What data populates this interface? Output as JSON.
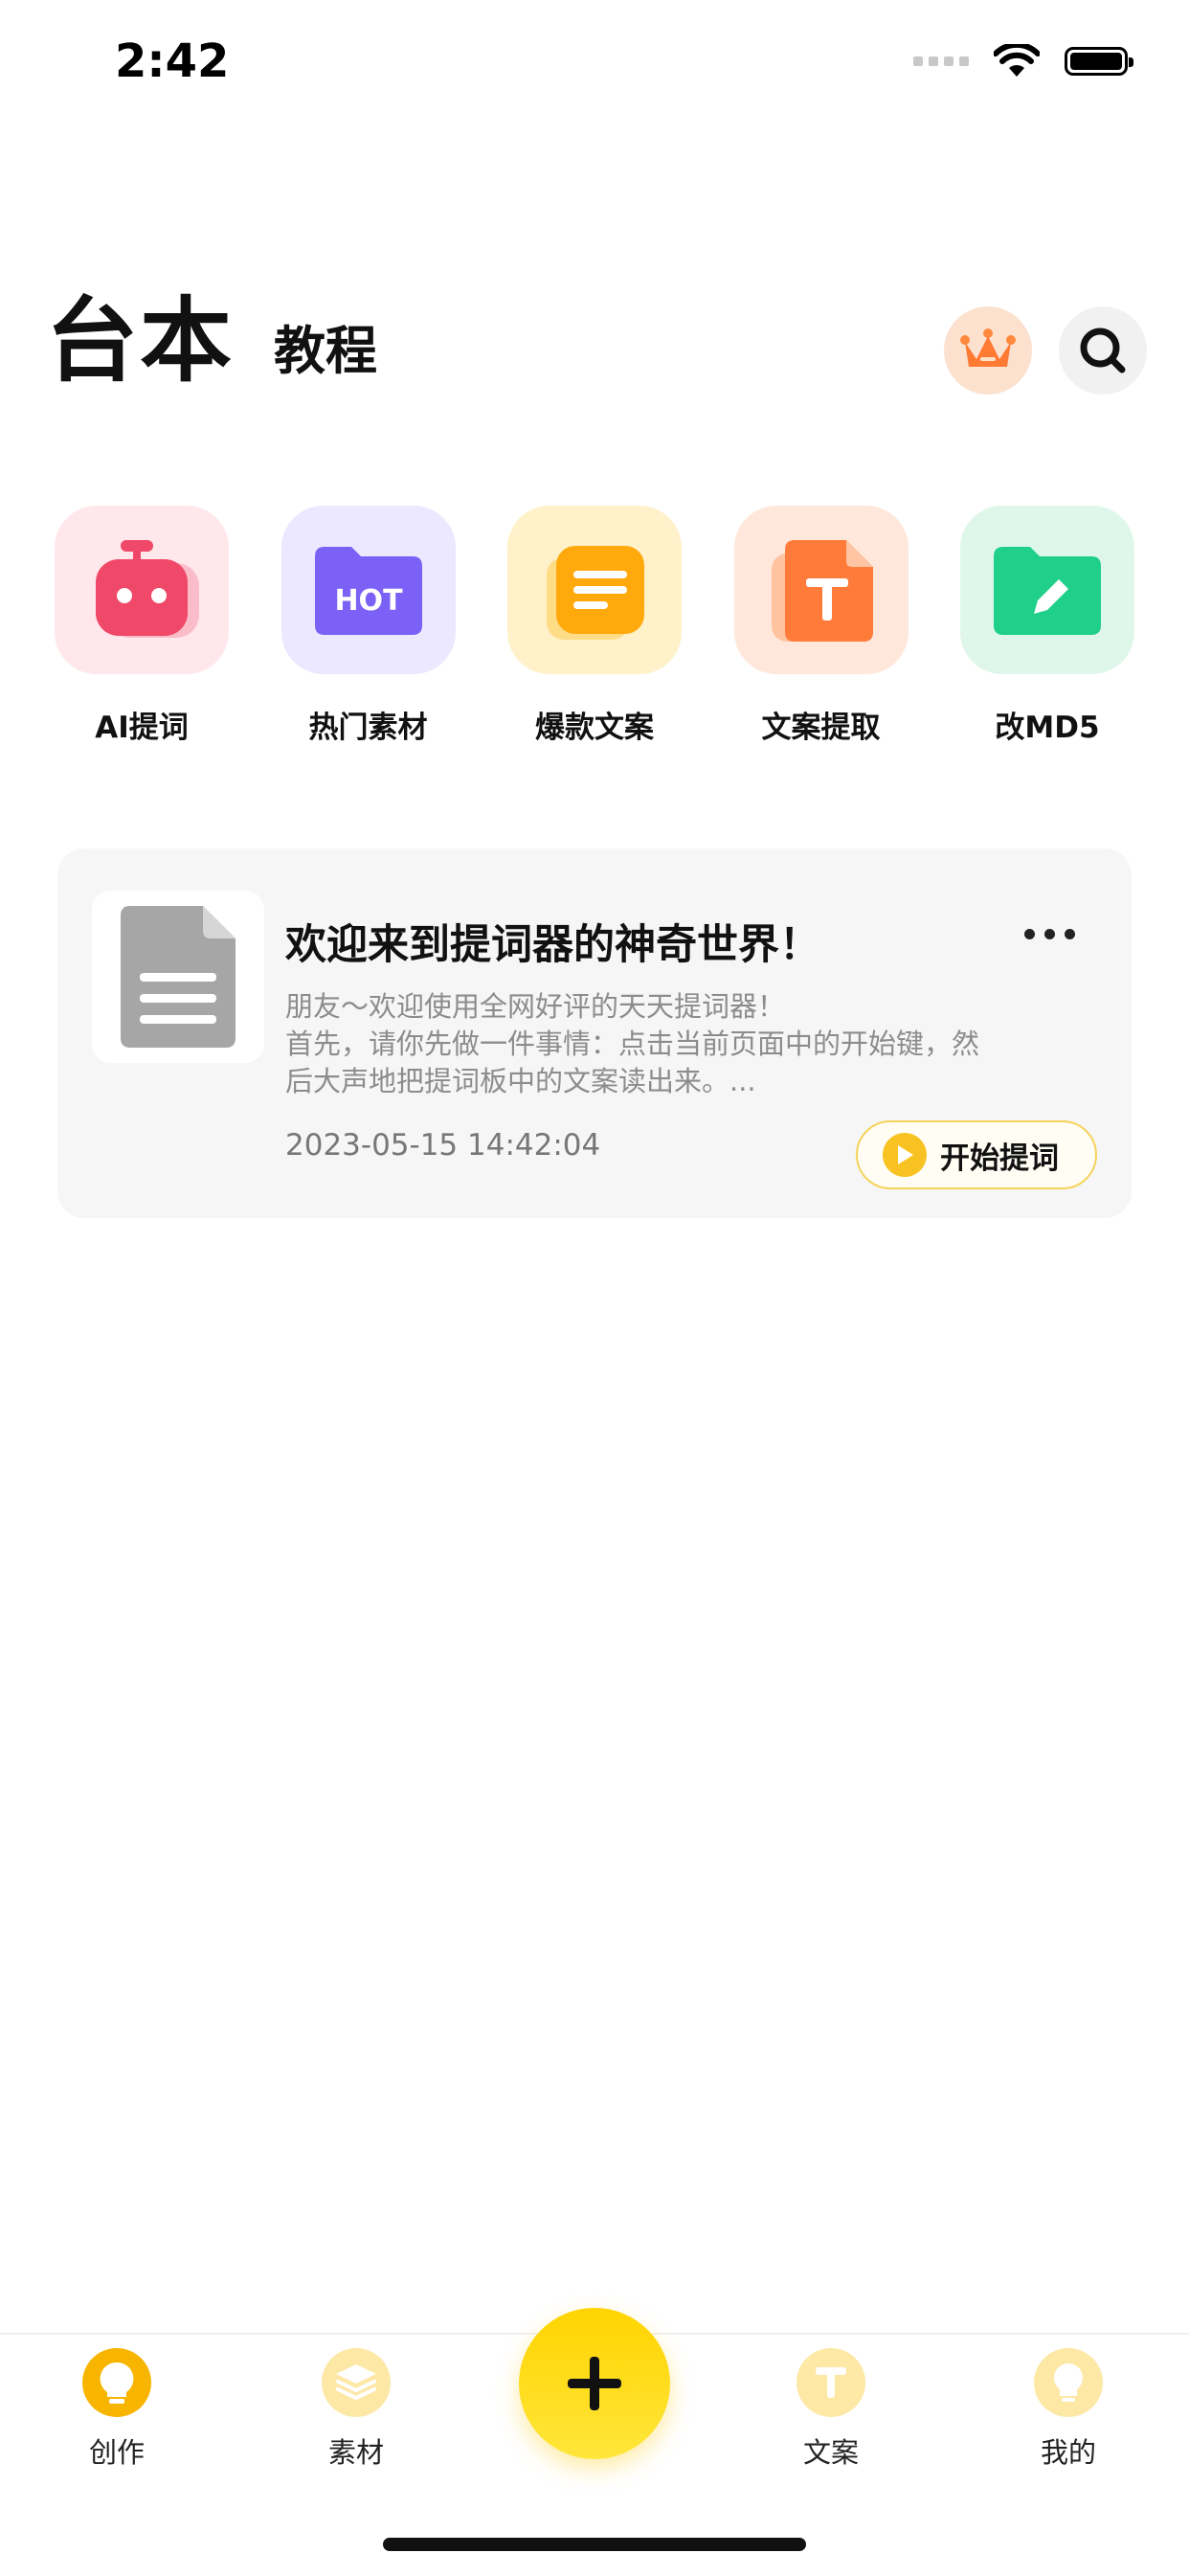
{
  "status_bar": {
    "time": "2:42"
  },
  "header": {
    "title": "台本",
    "subtitle": "教程"
  },
  "tools": [
    {
      "label": "AI提词",
      "icon": "robot-icon",
      "bg": "#ffe7ec",
      "color": "#f04868"
    },
    {
      "label": "热门素材",
      "icon": "hot-folder-icon",
      "bg": "#ebe8ff",
      "color": "#7b61f5"
    },
    {
      "label": "爆款文案",
      "icon": "note-icon",
      "bg": "#fff1c9",
      "color": "#ffa90c"
    },
    {
      "label": "文案提取",
      "icon": "text-file-icon",
      "bg": "#ffe8db",
      "color": "#ff7b3a"
    },
    {
      "label": "改MD5",
      "icon": "edit-folder-icon",
      "bg": "#dff7eb",
      "color": "#1fcf8a"
    }
  ],
  "card": {
    "title": "欢迎来到提词器的神奇世界！",
    "desc_line1": "朋友～欢迎使用全网好评的天天提词器！",
    "desc_line2": "首先，请你先做一件事情：点击当前页面中的开始键，然",
    "desc_line3": "后大声地把提词板中的文案读出来。...",
    "time": "2023-05-15 14:42:04",
    "start_label": "开始提词"
  },
  "tabbar": {
    "tabs": [
      {
        "label": "创作",
        "icon": "lightbulb-icon",
        "active": true
      },
      {
        "label": "素材",
        "icon": "layers-icon",
        "active": false
      },
      {
        "label": "文案",
        "icon": "text-t-icon",
        "active": false
      },
      {
        "label": "我的",
        "icon": "profile-icon",
        "active": false
      }
    ],
    "fab_icon": "plus-icon"
  },
  "colors": {
    "accent": "#ffd400",
    "active_tab": "#f8b500",
    "inactive_tab": "#fde8a6"
  }
}
